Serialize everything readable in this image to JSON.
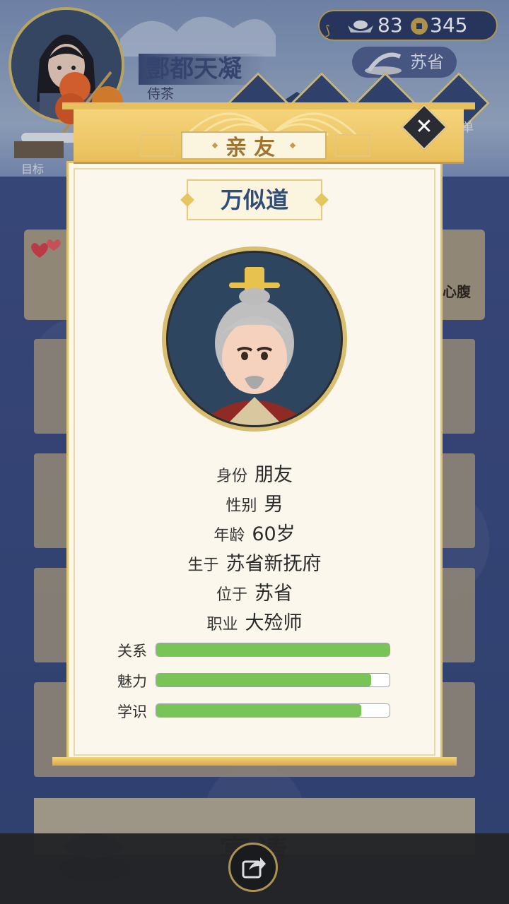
{
  "header": {
    "player_name": "酆都天凝",
    "player_title": "侍茶",
    "target_label": "目标",
    "menu_label": "菜单",
    "silver": "83",
    "coins": "345",
    "location": "苏省"
  },
  "background": {
    "partial_label_1": "心腹",
    "partial_label_2": "宴请"
  },
  "modal": {
    "tab_title": "亲友",
    "close_symbol": "✕",
    "name": "万似道",
    "info": [
      {
        "label": "身份",
        "value": "朋友"
      },
      {
        "label": "性别",
        "value": "男"
      },
      {
        "label": "年龄",
        "value": "60岁"
      },
      {
        "label": "生于",
        "value": "苏省新抚府"
      },
      {
        "label": "位于",
        "value": "苏省"
      },
      {
        "label": "职业",
        "value": "大殓师"
      }
    ],
    "stats": [
      {
        "label": "关系",
        "percent": 100
      },
      {
        "label": "魅力",
        "percent": 92
      },
      {
        "label": "学识",
        "percent": 88
      }
    ]
  },
  "colors": {
    "accent_gold": "#e2c26b",
    "bar_green": "#79c456",
    "name_blue": "#2f4d78"
  }
}
